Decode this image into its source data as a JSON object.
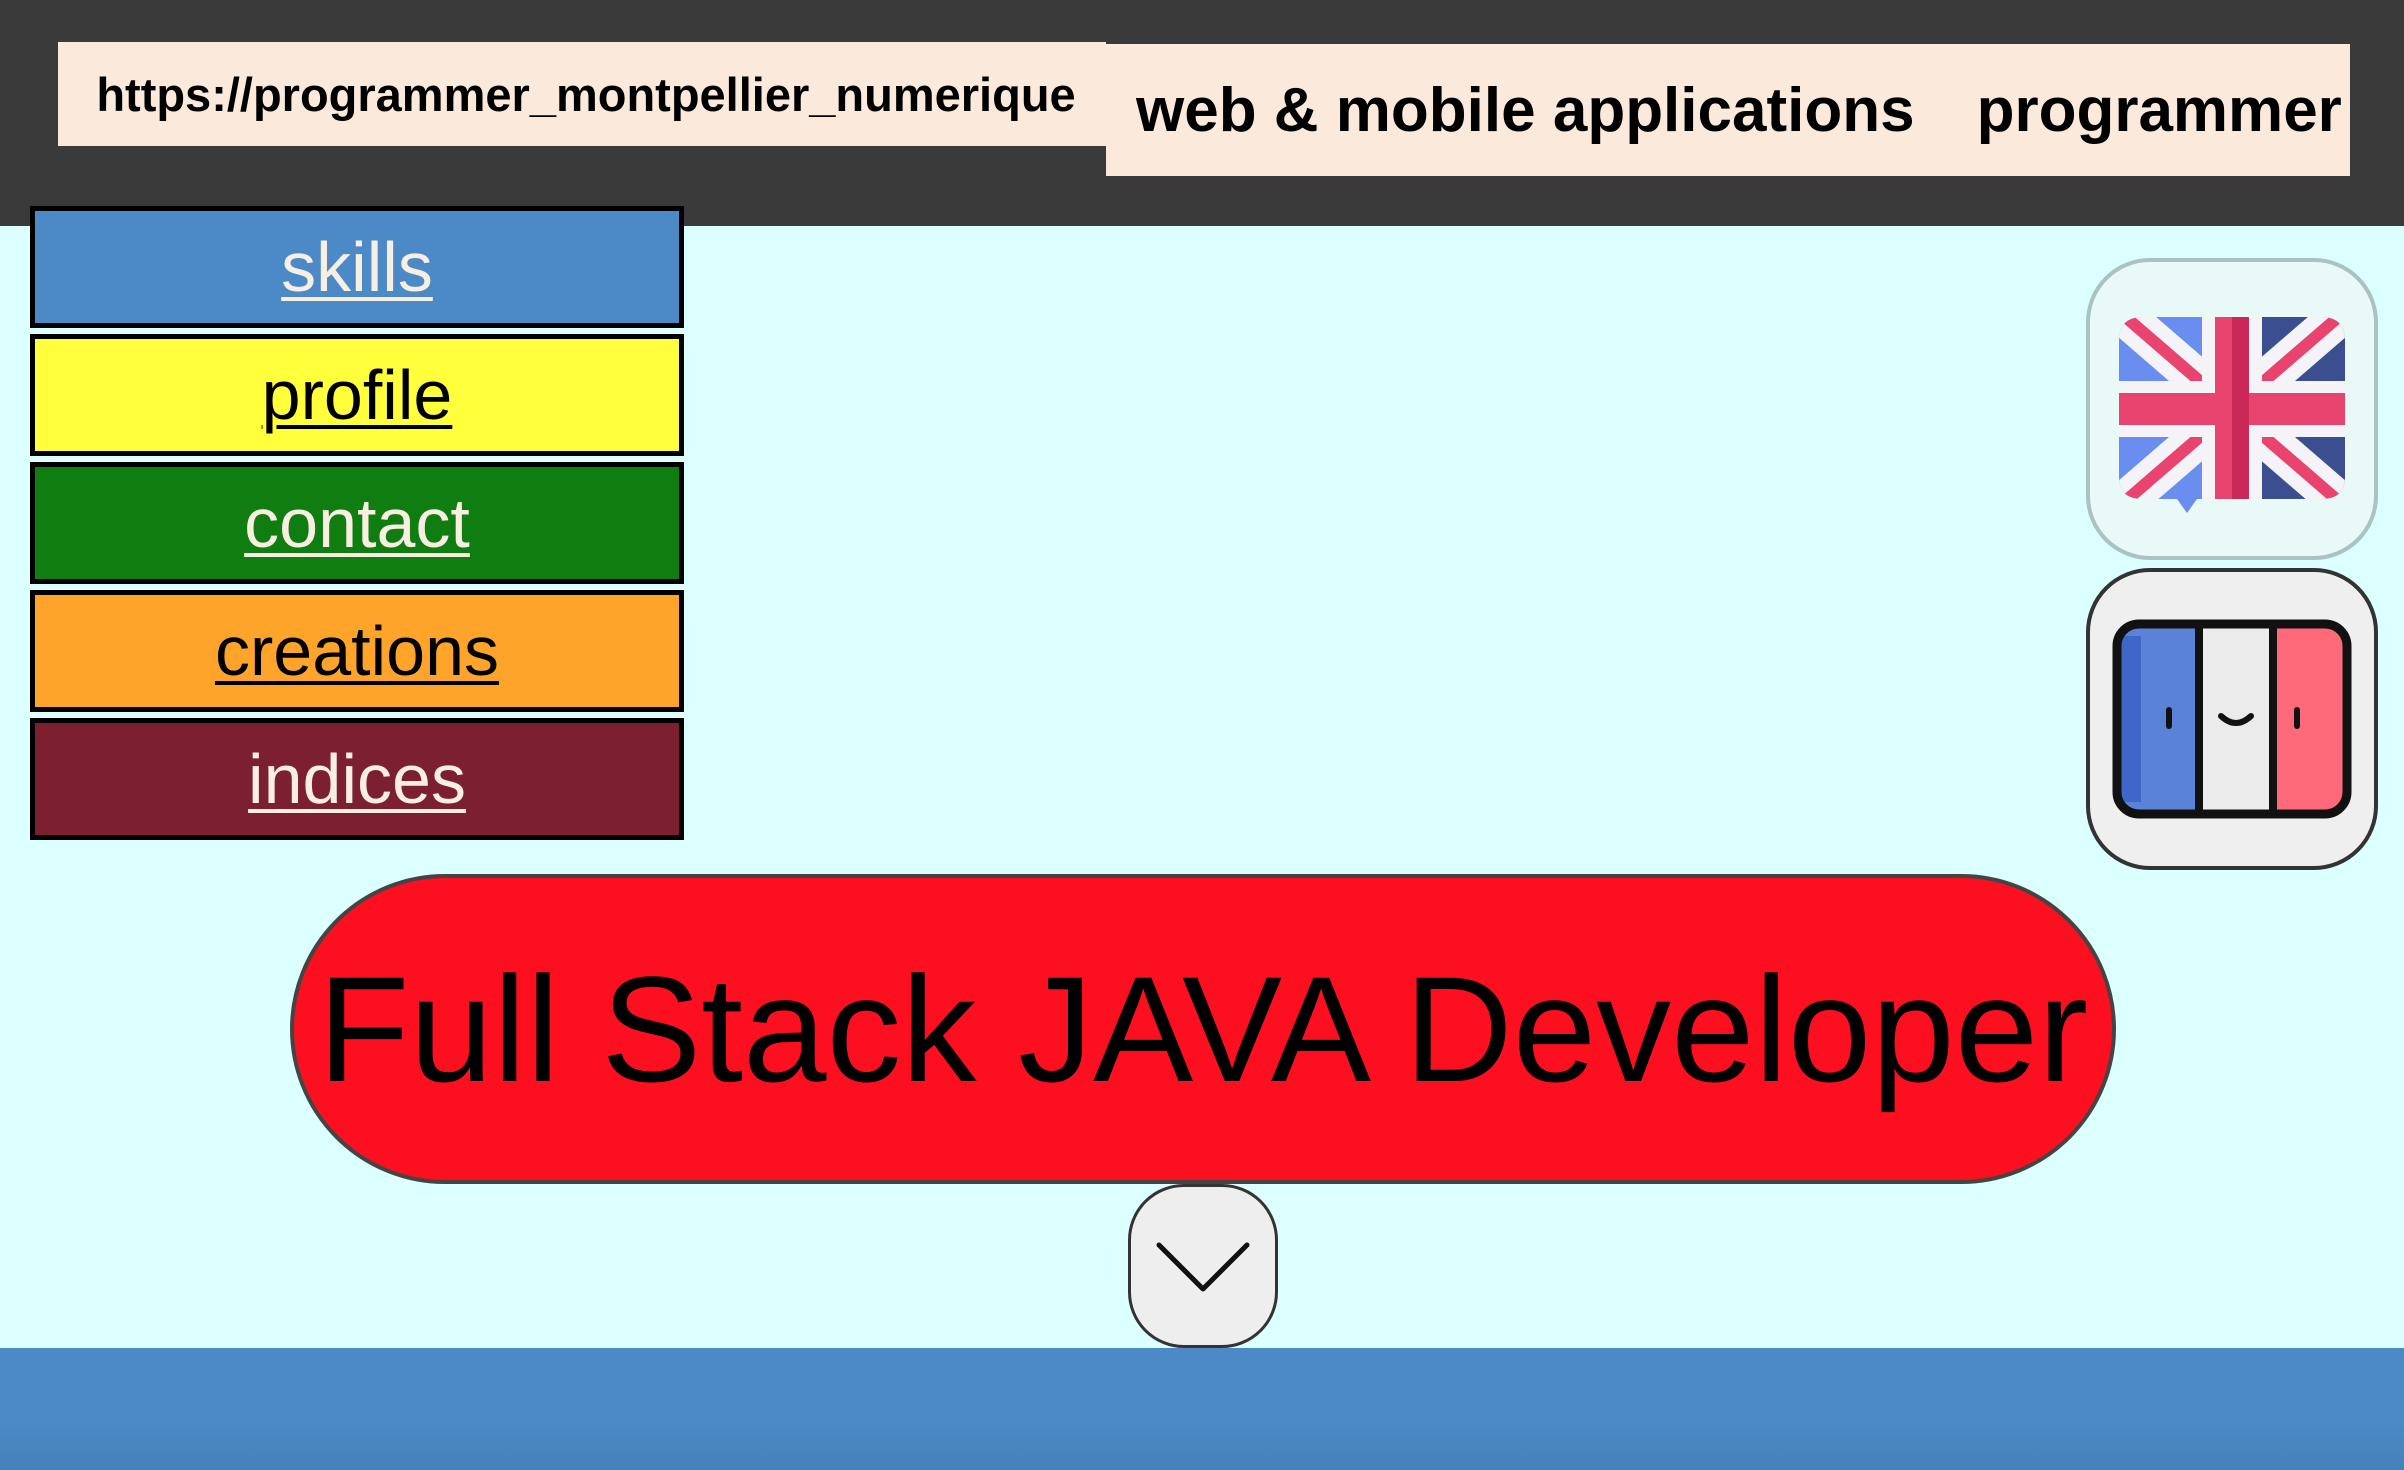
{
  "header": {
    "url_text": "https://programmer_montpellier_numerique",
    "title_part1": "web & mobile applications",
    "title_part2": "programmer"
  },
  "nav": {
    "items": [
      {
        "label": "skills",
        "color": "#4b8ac6"
      },
      {
        "label": "profile",
        "color": "#ffff3c"
      },
      {
        "label": "contact",
        "color": "#0f7d10"
      },
      {
        "label": "creations",
        "color": "#ffa42b"
      },
      {
        "label": "indices",
        "color": "#7c1f30"
      }
    ]
  },
  "language": {
    "english_icon": "uk-flag-speech-bubble-icon",
    "french_icon": "french-flag-smiley-icon"
  },
  "hero": {
    "text": "Full Stack JAVA Developer",
    "color": "#fc0f1f"
  },
  "scroll": {
    "icon": "chevron-down-icon"
  },
  "colors": {
    "header_bg": "#3a3a3a",
    "page_bg": "#dcffff",
    "label_bg": "#fbeadb",
    "footer_band": "#4b8ac6"
  }
}
